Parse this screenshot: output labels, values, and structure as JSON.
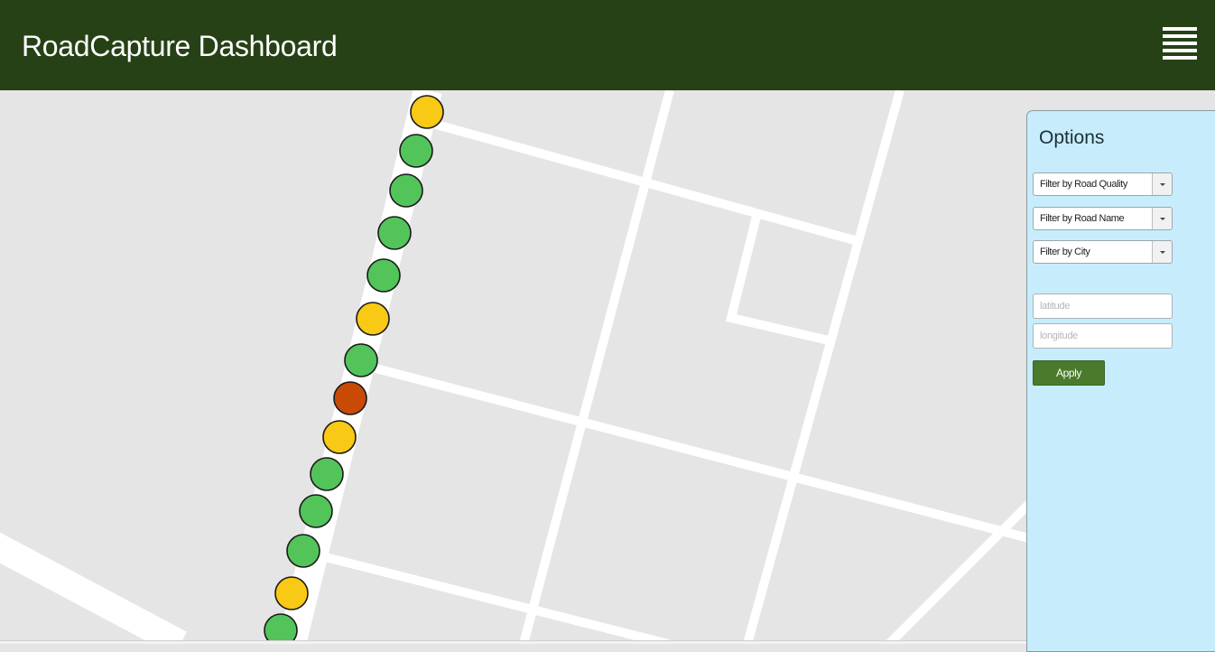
{
  "header": {
    "title": "RoadCapture Dashboard",
    "menu_icon": "hamburger-menu-icon"
  },
  "map": {
    "background_color": "#e5e5e5",
    "road_color": "#ffffff",
    "marker_colors": {
      "good": "#52c45a",
      "fair": "#f8c915",
      "poor": "#c94a05"
    },
    "markers": [
      {
        "quality": "fair"
      },
      {
        "quality": "good"
      },
      {
        "quality": "good"
      },
      {
        "quality": "good"
      },
      {
        "quality": "good"
      },
      {
        "quality": "fair"
      },
      {
        "quality": "good"
      },
      {
        "quality": "poor"
      },
      {
        "quality": "fair"
      },
      {
        "quality": "good"
      },
      {
        "quality": "good"
      },
      {
        "quality": "good"
      },
      {
        "quality": "fair"
      },
      {
        "quality": "good"
      }
    ]
  },
  "options": {
    "title": "Options",
    "filters": [
      {
        "label": "Filter by Road Quality"
      },
      {
        "label": "Filter by Road Name"
      },
      {
        "label": "Filter by City"
      }
    ],
    "latitude_placeholder": "latitude",
    "longitude_placeholder": "longitude",
    "apply_label": "Apply"
  },
  "colors": {
    "header_bg": "#274116",
    "panel_bg": "#c7edfc",
    "apply_bg": "#4a7a2b"
  }
}
